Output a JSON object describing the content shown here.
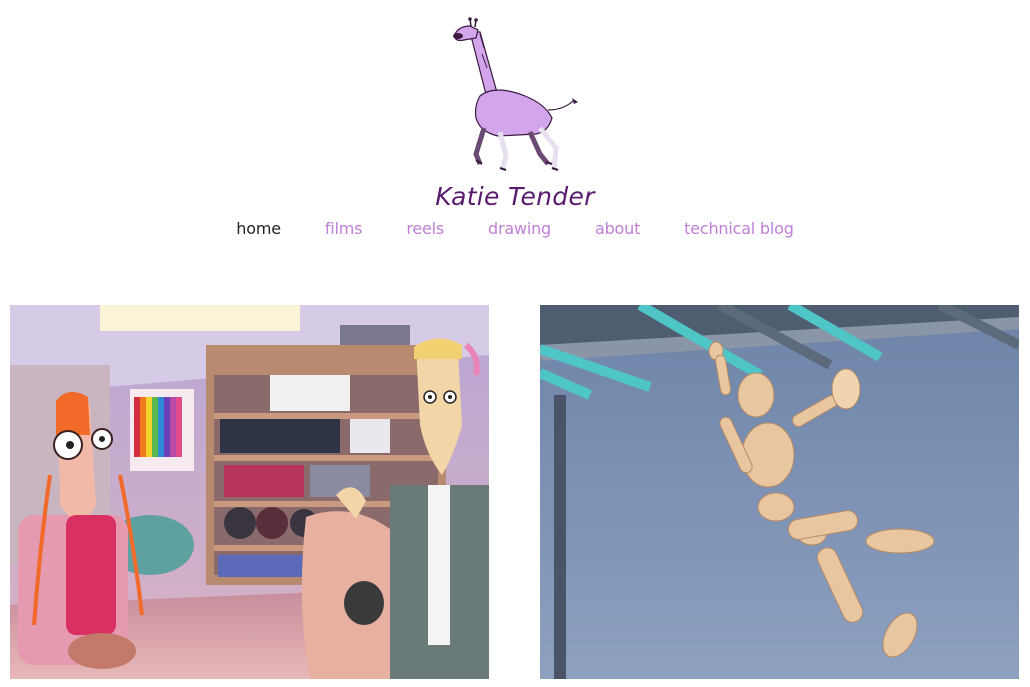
{
  "site": {
    "title": "Katie Tender",
    "logo_icon": "giraffe-logo-icon",
    "accent_color": "#c07fd6",
    "title_color": "#5a1a6e"
  },
  "nav": {
    "items": [
      {
        "label": "home",
        "active": true
      },
      {
        "label": "films",
        "active": false
      },
      {
        "label": "reels",
        "active": false
      },
      {
        "label": "drawing",
        "active": false
      },
      {
        "label": "about",
        "active": false
      },
      {
        "label": "technical blog",
        "active": false
      }
    ]
  },
  "gallery": {
    "items": [
      {
        "name": "classroom-scene-thumbnail"
      },
      {
        "name": "wooden-mannequin-monkey-bars-thumbnail"
      }
    ]
  }
}
